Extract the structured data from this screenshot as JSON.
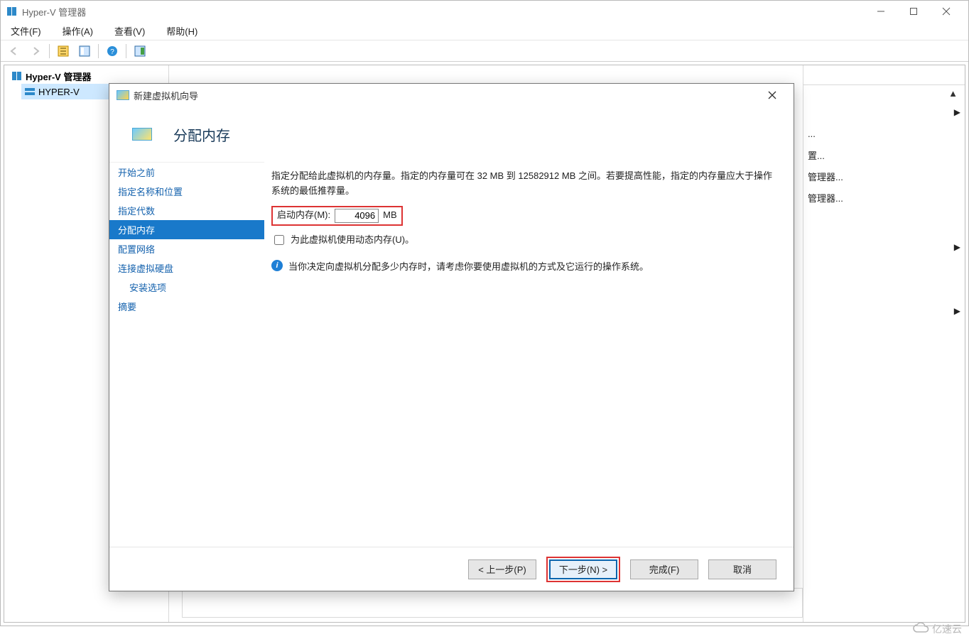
{
  "main": {
    "title": "Hyper-V 管理器",
    "menus": {
      "file": "文件(F)",
      "action": "操作(A)",
      "view": "查看(V)",
      "help": "帮助(H)"
    },
    "tree": {
      "root": "Hyper-V 管理器",
      "child": "HYPER-V"
    },
    "actions": {
      "arrow_up": "▲",
      "row1": "置...",
      "row2": "管理器...",
      "row3": "管理器...",
      "more": "..."
    }
  },
  "wizard": {
    "window_title": "新建虚拟机向导",
    "heading": "分配内存",
    "steps": {
      "before": "开始之前",
      "name": "指定名称和位置",
      "gen": "指定代数",
      "memory": "分配内存",
      "network": "配置网络",
      "disk": "连接虚拟硬盘",
      "install": "安装选项",
      "summary": "摘要"
    },
    "content": {
      "desc": "指定分配给此虚拟机的内存量。指定的内存量可在 32 MB 到 12582912 MB 之间。若要提高性能，指定的内存量应大于操作系统的最低推荐量。",
      "mem_label": "启动内存(M):",
      "mem_value": "4096",
      "mem_unit": "MB",
      "dyn_label": "为此虚拟机使用动态内存(U)。",
      "info": "当你决定向虚拟机分配多少内存时，请考虑你要使用虚拟机的方式及它运行的操作系统。"
    },
    "buttons": {
      "prev": "< 上一步(P)",
      "next": "下一步(N) >",
      "finish": "完成(F)",
      "cancel": "取消"
    }
  },
  "watermark": "亿速云"
}
